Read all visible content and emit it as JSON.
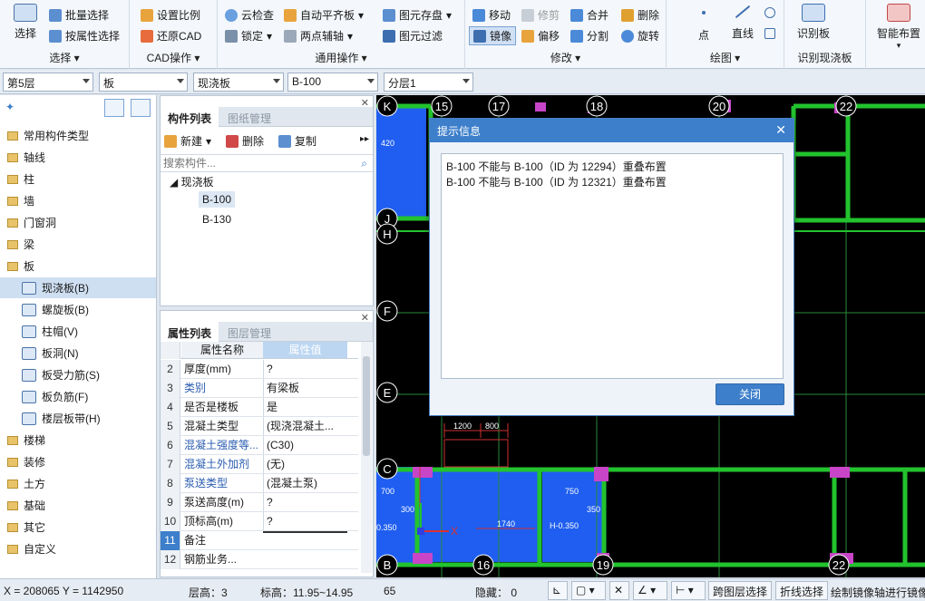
{
  "ribbon": {
    "select_group": {
      "big_label": "选择",
      "batch_select": "批量选择",
      "attr_select": "按属性选择",
      "group_label": "选择"
    },
    "cad_group": {
      "set_scale": "设置比例",
      "restore_cad": "还原CAD",
      "group_label": "CAD操作"
    },
    "common_group": {
      "cloud_check": "云检查",
      "auto_align": "自动平齐板",
      "lock": "锁定",
      "two_point_axis": "两点辅轴",
      "save_elements": "图元存盘",
      "filter_elements": "图元过滤",
      "group_label": "通用操作"
    },
    "modify_group": {
      "move": "移动",
      "trim": "修剪",
      "merge": "合并",
      "delete": "删除",
      "mirror": "镜像",
      "offset": "偏移",
      "split": "分割",
      "rotate": "旋转",
      "group_label": "修改"
    },
    "draw_group": {
      "point": "点",
      "line": "直线",
      "group_label": "绘图"
    },
    "recognize_group": {
      "recognize_slab": "识别板",
      "group_label": "识别现浇板"
    },
    "smart_group": {
      "smart_layout": "智能布置"
    }
  },
  "combos": {
    "floor": "第5层",
    "type": "板",
    "subtype": "现浇板",
    "component": "B-100",
    "layer": "分层1"
  },
  "tree": {
    "items": [
      "常用构件类型",
      "轴线",
      "柱",
      "墙",
      "门窗洞",
      "梁",
      "板"
    ],
    "slab_children": [
      "现浇板(B)",
      "螺旋板(B)",
      "柱帽(V)",
      "板洞(N)",
      "板受力筋(S)",
      "板负筋(F)",
      "楼层板带(H)"
    ],
    "items_after": [
      "楼梯",
      "装修",
      "土方",
      "基础",
      "其它",
      "自定义"
    ]
  },
  "component_panel": {
    "tab_active": "构件列表",
    "tab_inactive": "图纸管理",
    "new_label": "新建",
    "delete_label": "删除",
    "copy_label": "复制",
    "search_placeholder": "搜索构件...",
    "root": "现浇板",
    "children": [
      "B-100",
      "B-130"
    ]
  },
  "property_panel": {
    "tab_active": "属性列表",
    "tab_inactive": "图层管理",
    "header_name": "属性名称",
    "header_value": "属性值",
    "rows": [
      {
        "n": "2",
        "k": "厚度(mm)",
        "v": "?"
      },
      {
        "n": "3",
        "k": "类别",
        "v": "有梁板"
      },
      {
        "n": "4",
        "k": "是否是楼板",
        "v": "是"
      },
      {
        "n": "5",
        "k": "混凝土类型",
        "v": "(现浇混凝土..."
      },
      {
        "n": "6",
        "k": "混凝土强度等...",
        "v": "(C30)"
      },
      {
        "n": "7",
        "k": "混凝土外加剂",
        "v": "(无)"
      },
      {
        "n": "8",
        "k": "泵送类型",
        "v": "(混凝土泵)"
      },
      {
        "n": "9",
        "k": "泵送高度(m)",
        "v": "?"
      },
      {
        "n": "10",
        "k": "顶标高(m)",
        "v": "?"
      },
      {
        "n": "11",
        "k": "备注",
        "v": ""
      },
      {
        "n": "12",
        "k": "钢筋业务...",
        "v": ""
      }
    ]
  },
  "cad": {
    "axis_labels_top": [
      "15",
      "17",
      "18",
      "20",
      "22"
    ],
    "axis_labels_left": [
      "K",
      "J",
      "H",
      "F",
      "E",
      "C",
      "B"
    ],
    "axis_labels_bottom": [
      "16",
      "19",
      "22"
    ],
    "dims": [
      "420",
      "1200",
      "800",
      "1740",
      "H-0.350",
      "350",
      "300",
      "700",
      "750",
      "0.350"
    ],
    "xaxis": "X"
  },
  "dialog": {
    "title": "提示信息",
    "lines": [
      "B-100 不能与 B-100（ID 为 12294）重叠布置",
      "B-100 不能与 B-100（ID 为 12321）重叠布置"
    ],
    "close_button": "关闭"
  },
  "status": {
    "coords": "X = 208065 Y = 1142950",
    "floor_height": "层高：3",
    "elevation": "标高：11.95~14.95",
    "count": "65",
    "hidden": "隐藏： 0",
    "cross_layer": "跨图层选择",
    "polyline_select": "折线选择",
    "hint": "绘制镜像轴进行镜像"
  },
  "colors": {
    "accent": "#3d7fcb",
    "cad_bg": "#000000",
    "slab_fill": "#1f5ef0",
    "wall_green": "#22c32e",
    "magenta": "#c845c8"
  }
}
